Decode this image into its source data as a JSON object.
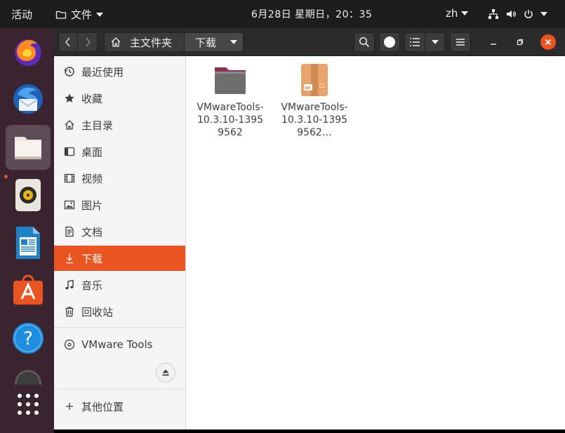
{
  "topbar": {
    "activities": "活动",
    "app_name": "文件",
    "clock": "6月28日 星期日，20：35",
    "lang": "zh"
  },
  "dock": {
    "items": [
      "firefox-icon",
      "thunderbird-icon",
      "files-icon",
      "rhythmbox-icon",
      "libreoffice-writer-icon",
      "software-icon",
      "help-icon",
      "app-grid-icon"
    ]
  },
  "headerbar": {
    "crumb_home": "主文件夹",
    "crumb_current": "下载"
  },
  "sidebar": {
    "items": [
      {
        "label": "最近使用",
        "icon": "recent-icon"
      },
      {
        "label": "收藏",
        "icon": "star-icon"
      },
      {
        "label": "主目录",
        "icon": "home-icon"
      },
      {
        "label": "桌面",
        "icon": "desktop-icon"
      },
      {
        "label": "视频",
        "icon": "video-icon"
      },
      {
        "label": "图片",
        "icon": "picture-icon"
      },
      {
        "label": "文档",
        "icon": "document-icon"
      },
      {
        "label": "下载",
        "icon": "download-icon"
      },
      {
        "label": "音乐",
        "icon": "music-icon"
      },
      {
        "label": "回收站",
        "icon": "trash-icon"
      }
    ],
    "device": "VMware Tools",
    "other": "其他位置"
  },
  "files": [
    {
      "name": "VMwareTools-10.3.10-13959562",
      "type": "folder"
    },
    {
      "name": "VMwareTools-10.3.10-13959562…",
      "type": "archive"
    }
  ],
  "colors": {
    "accent": "#e95420",
    "topbar": "#1d1d1d",
    "dock": "#3a2430",
    "headerbar": "#2b2b2b"
  }
}
